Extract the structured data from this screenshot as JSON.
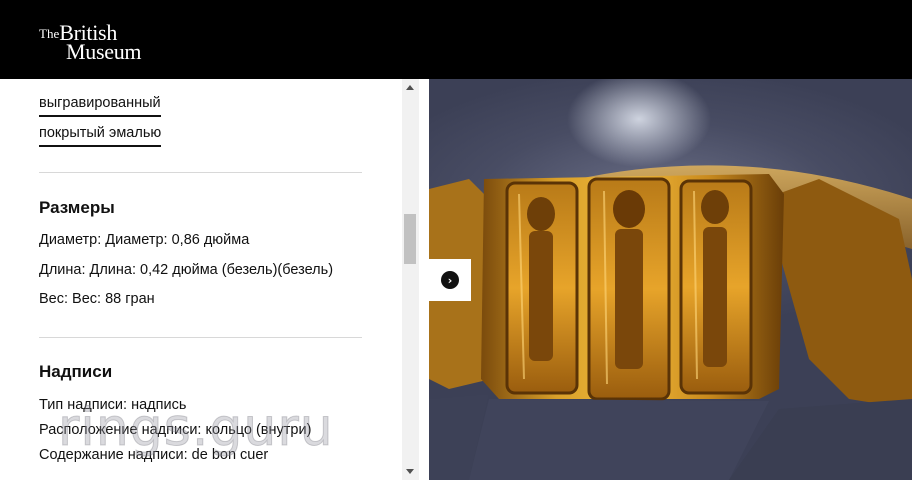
{
  "header": {
    "logo_the": "The",
    "logo_british": "British",
    "logo_museum": "Museum"
  },
  "techniques": [
    "выгравированный",
    "покрытый эмалью"
  ],
  "dimensions": {
    "title": "Размеры",
    "rows": [
      "Диаметр: Диаметр: 0,86 дюйма",
      "Длина: Длина: 0,42 дюйма (безель)(безель)",
      "Вес: Вес: 88 гран"
    ]
  },
  "inscriptions": {
    "title": "Надписи",
    "rows": [
      "Тип надписи: надпись",
      "Расположение надписи: кольцо (внутри)",
      "Содержание надписи: de bon cuer"
    ]
  },
  "watermark": "rings.guru",
  "colors": {
    "header_bg": "#000000",
    "accent": "#111111",
    "gold": "#c8901f"
  },
  "icons": {
    "next": "chevron-right-circle-icon"
  }
}
